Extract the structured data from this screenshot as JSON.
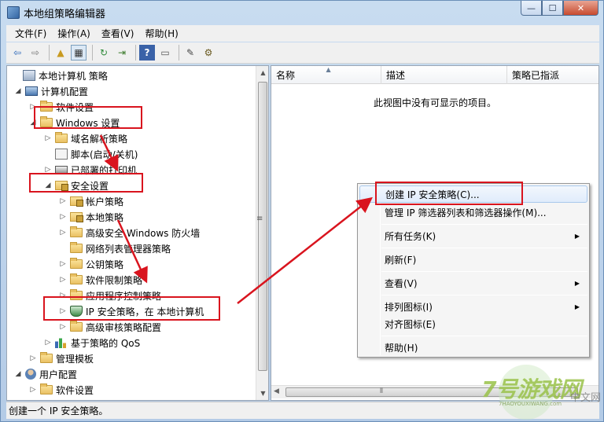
{
  "window": {
    "title": "本地组策略编辑器",
    "buttons": {
      "minimize": "—",
      "maximize": "☐",
      "close": "✕"
    }
  },
  "menubar": [
    {
      "label": "文件(F)"
    },
    {
      "label": "操作(A)"
    },
    {
      "label": "查看(V)"
    },
    {
      "label": "帮助(H)"
    }
  ],
  "toolbar": [
    {
      "icon": "back-arrow-icon",
      "glyph": "⇦"
    },
    {
      "icon": "forward-arrow-icon",
      "glyph": "⇨"
    },
    {
      "icon": "up-folder-icon",
      "glyph": "▲"
    },
    {
      "icon": "show-tree-icon",
      "glyph": "▦"
    },
    {
      "icon": "refresh-icon",
      "glyph": "↻"
    },
    {
      "icon": "export-icon",
      "glyph": "⇥"
    },
    {
      "icon": "help-icon",
      "glyph": "?"
    },
    {
      "icon": "view-icon",
      "glyph": "▭"
    },
    {
      "icon": "new-policy-icon",
      "glyph": "✎"
    },
    {
      "icon": "manage-filters-icon",
      "glyph": "⚙"
    }
  ],
  "tree": [
    {
      "label": "本地计算机 策略",
      "icon": "policy-icon",
      "expander": ""
    },
    {
      "label": "计算机配置",
      "icon": "computer-icon",
      "expander": "◢"
    },
    {
      "label": "软件设置",
      "icon": "folder-icon",
      "expander": "▷"
    },
    {
      "label": "Windows 设置",
      "icon": "folder-icon",
      "expander": "◢"
    },
    {
      "label": "域名解析策略",
      "icon": "folder-icon",
      "expander": "▷"
    },
    {
      "label": "脚本(启动/关机)",
      "icon": "script-icon",
      "expander": ""
    },
    {
      "label": "已部署的打印机",
      "icon": "printer-icon",
      "expander": "▷"
    },
    {
      "label": "安全设置",
      "icon": "lock-folder-icon",
      "expander": "◢"
    },
    {
      "label": "帐户策略",
      "icon": "lock-folder-icon",
      "expander": "▷"
    },
    {
      "label": "本地策略",
      "icon": "lock-folder-icon",
      "expander": "▷"
    },
    {
      "label": "高级安全 Windows 防火墙",
      "icon": "folder-icon",
      "expander": "▷"
    },
    {
      "label": "网络列表管理器策略",
      "icon": "folder-icon",
      "expander": ""
    },
    {
      "label": "公钥策略",
      "icon": "folder-icon",
      "expander": "▷"
    },
    {
      "label": "软件限制策略",
      "icon": "folder-icon",
      "expander": "▷"
    },
    {
      "label": "应用程序控制策略",
      "icon": "folder-icon",
      "expander": "▷"
    },
    {
      "label": "IP 安全策略，在 本地计算机",
      "icon": "shield-icon",
      "expander": "▷"
    },
    {
      "label": "高级审核策略配置",
      "icon": "folder-icon",
      "expander": "▷"
    },
    {
      "label": "基于策略的 QoS",
      "icon": "bars-icon",
      "expander": "▷"
    },
    {
      "label": "管理模板",
      "icon": "folder-icon",
      "expander": "▷"
    },
    {
      "label": "用户配置",
      "icon": "user-icon",
      "expander": "◢"
    },
    {
      "label": "软件设置",
      "icon": "folder-icon",
      "expander": "▷"
    }
  ],
  "list": {
    "columns": [
      "名称",
      "描述",
      "策略已指派"
    ],
    "empty_message": "此视图中没有可显示的项目。"
  },
  "context_menu": [
    {
      "label": "创建 IP 安全策略(C)...",
      "submenu": false
    },
    {
      "label": "管理 IP 筛选器列表和筛选器操作(M)...",
      "submenu": false
    },
    {
      "label": "所有任务(K)",
      "submenu": true
    },
    {
      "label": "刷新(F)",
      "submenu": false
    },
    {
      "label": "查看(V)",
      "submenu": true
    },
    {
      "label": "排列图标(I)",
      "submenu": true
    },
    {
      "label": "对齐图标(E)",
      "submenu": false
    },
    {
      "label": "帮助(H)",
      "submenu": false
    }
  ],
  "statusbar": {
    "text": "创建一个 IP 安全策略。"
  },
  "watermark": {
    "main": "7号游戏网",
    "sub": "7HAOYOUXIWANG.com",
    "cn": "中文网"
  },
  "colors": {
    "annotation_red": "#d9141e",
    "window_frame": "#b4cbe6"
  }
}
